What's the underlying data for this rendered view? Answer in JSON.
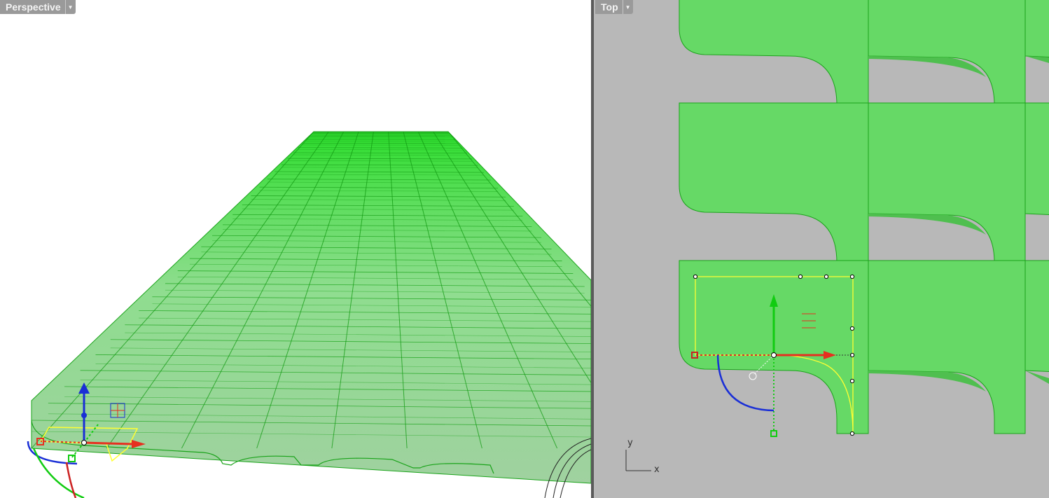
{
  "perspective_viewport": {
    "title": "Perspective",
    "menu_icon": "triangle-down-icon"
  },
  "top_viewport": {
    "title": "Top",
    "menu_icon": "triangle-down-icon",
    "axis_indicator": {
      "x_label": "x",
      "y_label": "y"
    }
  },
  "colors": {
    "surface_green": "#66d966",
    "edge_green": "#1aa31a",
    "selection_yellow": "#ffff33",
    "gumball_x": "#e63020",
    "gumball_y": "#11cc11",
    "gumball_z": "#1a2fd6",
    "top_background": "#b8b8b8",
    "tab_gray": "#9a9a9a"
  }
}
